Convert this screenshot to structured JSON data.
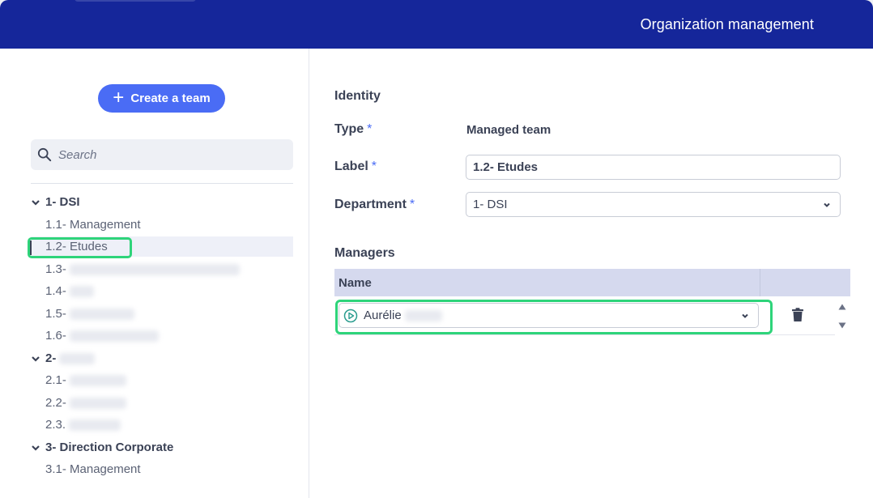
{
  "header": {
    "title": "Organization management"
  },
  "sidebar": {
    "create_button": "Create a team",
    "search_placeholder": "Search",
    "tree": [
      {
        "label": "1- DSI",
        "children": [
          "1.1- Management",
          "1.2- Etudes",
          "1.3-",
          "1.4-",
          "1.5-",
          "1.6-"
        ]
      },
      {
        "label": "2-",
        "children": [
          "2.1-",
          "2.2-",
          "2.3."
        ]
      },
      {
        "label": "3- Direction Corporate",
        "children": [
          "3.1- Management"
        ]
      }
    ],
    "selected": "1.2- Etudes"
  },
  "identity": {
    "section_title": "Identity",
    "type_label": "Type",
    "type_value": "Managed team",
    "label_label": "Label",
    "label_value": "1.2- Etudes",
    "department_label": "Department",
    "department_value": "1- DSI",
    "required_mark": "*"
  },
  "managers": {
    "section_title": "Managers",
    "column_name": "Name",
    "rows": [
      {
        "name": "Aurélie"
      }
    ]
  },
  "colors": {
    "header": "#15269a",
    "accent": "#4a6cf5",
    "highlight": "#2ed47a"
  },
  "icons": [
    "plus-icon",
    "search-icon",
    "chevron-down-icon",
    "play-circle-icon",
    "trash-icon",
    "caret-up-icon",
    "caret-down-icon"
  ]
}
